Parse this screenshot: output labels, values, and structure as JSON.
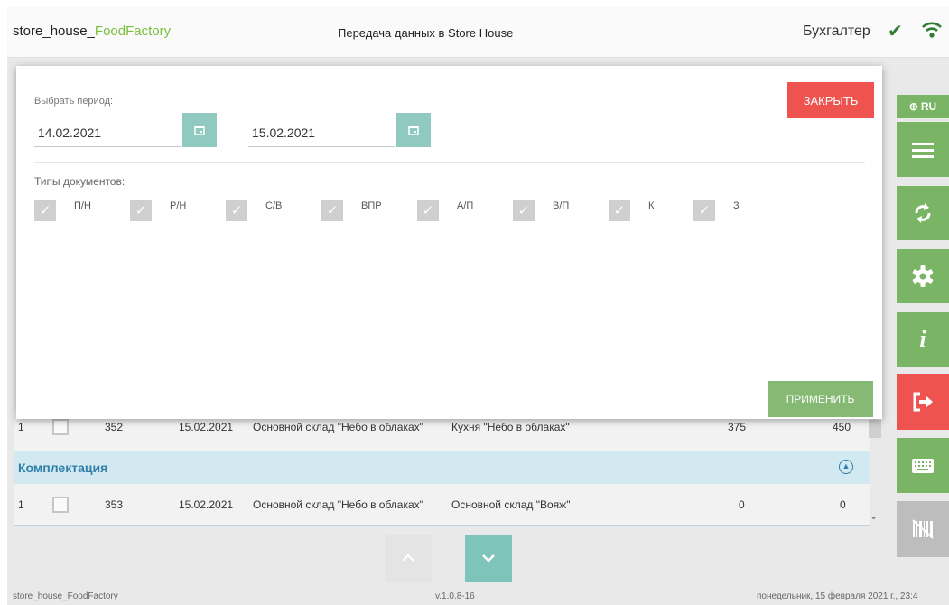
{
  "header": {
    "brand_prefix": "store_house_",
    "brand_accent": "FoodFactory",
    "title": "Передача данных в Store House",
    "role": "Бухгалтер"
  },
  "sidebar": {
    "language_label": "RU",
    "buttons": [
      {
        "name": "menu-icon"
      },
      {
        "name": "sync-icon"
      },
      {
        "name": "settings-icon"
      },
      {
        "name": "info-icon",
        "glyph": "i"
      },
      {
        "name": "logout-icon"
      },
      {
        "name": "keyboard-icon"
      },
      {
        "name": "barcode-off-icon"
      }
    ]
  },
  "filter_panel": {
    "period_label": "Выбрать период:",
    "date_from": "14.02.2021",
    "date_to": "15.02.2021",
    "close_label": "ЗАКРЫТЬ",
    "doc_types_label": "Типы документов:",
    "doc_types": [
      {
        "label": "П/Н",
        "checked": true
      },
      {
        "label": "Р/Н",
        "checked": true
      },
      {
        "label": "С/В",
        "checked": true
      },
      {
        "label": "ВПР",
        "checked": true
      },
      {
        "label": "А/П",
        "checked": true
      },
      {
        "label": "В/П",
        "checked": true
      },
      {
        "label": "К",
        "checked": true
      },
      {
        "label": "З",
        "checked": true
      }
    ],
    "apply_label": "ПРИМЕНИТЬ"
  },
  "list": {
    "rows_before": [
      {
        "num": "1",
        "doc": "352",
        "date": "15.02.2021",
        "from": "Основной склад \"Небо в облаках\"",
        "to": "Кухня \"Небо в облаках\"",
        "sum1": "375",
        "sum2": "450"
      }
    ],
    "section": {
      "title": "Комплектация"
    },
    "rows_after": [
      {
        "num": "1",
        "doc": "353",
        "date": "15.02.2021",
        "from": "Основной склад \"Небо в облаках\"",
        "to": "Основной склад \"Вояж\"",
        "sum1": "0",
        "sum2": "0"
      }
    ]
  },
  "footer": {
    "left": "store_house_FoodFactory",
    "version": "v.1.0.8-16",
    "datetime": "понедельник, 15 февраля 2021 г., 23:4"
  },
  "colors": {
    "accent_green": "#79b565",
    "danger_red": "#ef5350",
    "teal": "#8fc9bf",
    "section_bg": "#d3e9f1"
  }
}
